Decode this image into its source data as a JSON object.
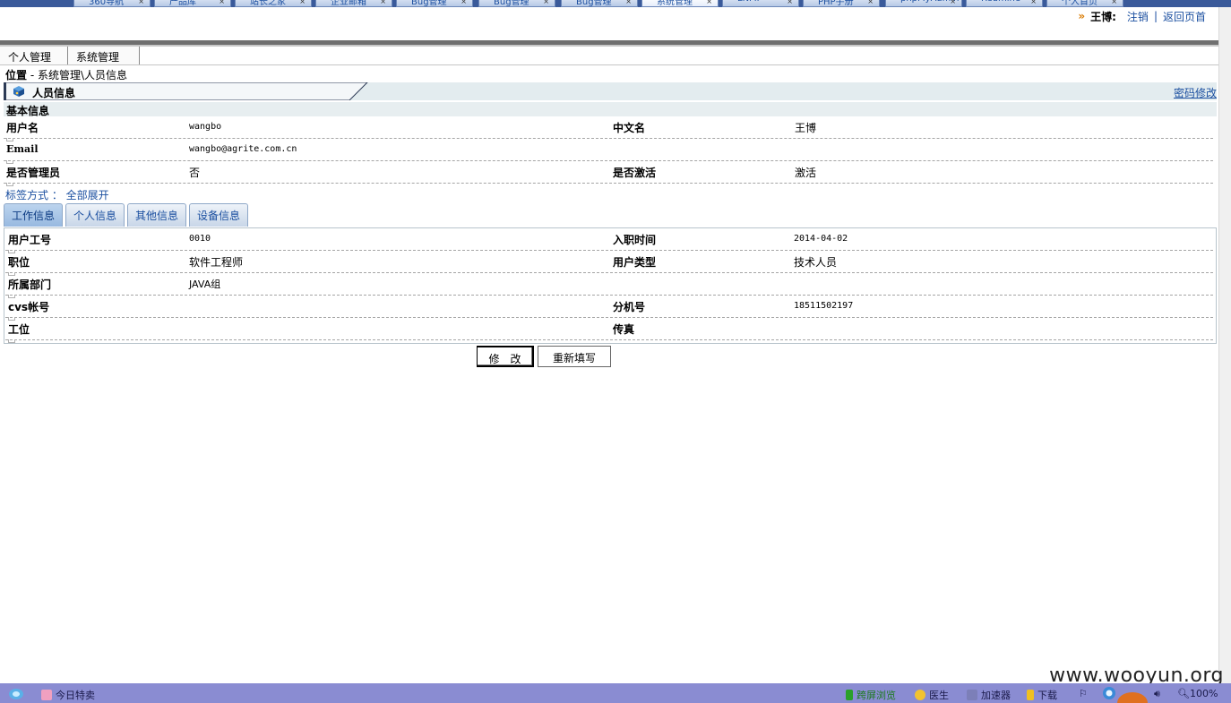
{
  "browser_tabs": [
    "360导航",
    "产品库",
    "站长之家",
    "企业邮箱",
    "Bug管理",
    "Bug管理",
    "Bug管理",
    "系统管理",
    "LNMP",
    "PHP手册",
    "phpMyAdmin",
    "Redmine",
    "个人首页"
  ],
  "userbar": {
    "arrow": "»",
    "user": "王博:",
    "logout": "注销",
    "sep": "|",
    "home": "返回页首"
  },
  "menu": {
    "items": [
      "个人管理",
      "系统管理"
    ]
  },
  "breadcrumb": {
    "label": "位置",
    "dash": " - ",
    "path": "系统管理\\人员信息"
  },
  "panel": {
    "title": "人员信息",
    "password_link": "密码修改"
  },
  "basic": {
    "heading": "基本信息",
    "rows": [
      {
        "l1": "用户名",
        "v1": "wangbo",
        "l2": "中文名",
        "v2": "王博"
      },
      {
        "l1": "Email",
        "v1": "wangbo@agrite.com.cn",
        "l2": "",
        "v2": ""
      },
      {
        "l1": "是否管理员",
        "v1": "否",
        "l2": "是否激活",
        "v2": "激活"
      }
    ]
  },
  "label_mode": {
    "label": "标签方式 ：",
    "value": "全部展开"
  },
  "tabs": [
    {
      "label": "工作信息",
      "active": true
    },
    {
      "label": "个人信息",
      "active": false
    },
    {
      "label": "其他信息",
      "active": false
    },
    {
      "label": "设备信息",
      "active": false
    }
  ],
  "work": {
    "rows": [
      {
        "l1": "用户工号",
        "v1": "0010",
        "l2": "入职时间",
        "v2": "2014-04-02"
      },
      {
        "l1": "职位",
        "v1": "软件工程师",
        "l2": "用户类型",
        "v2": "技术人员"
      },
      {
        "l1": "所属部门",
        "v1": "JAVA组",
        "l2": "",
        "v2": ""
      },
      {
        "l1": "cvs帐号",
        "v1": "",
        "l2": "分机号",
        "v2": "18511502197"
      },
      {
        "l1": "工位",
        "v1": "",
        "l2": "传真",
        "v2": ""
      }
    ]
  },
  "buttons": {
    "modify": "修　改",
    "reset": "重新填写"
  },
  "watermark": "www.wooyun.org",
  "statusbar": {
    "deals": "今日特卖",
    "cross_screen": "跨屏浏览",
    "doctor": "医生",
    "accelerator": "加速器",
    "download": "下载",
    "zoom": "100%"
  },
  "colors": {
    "link": "#1b4fa0",
    "statusbar": "#8a8cd2",
    "tab_active": "#98b9e0"
  }
}
